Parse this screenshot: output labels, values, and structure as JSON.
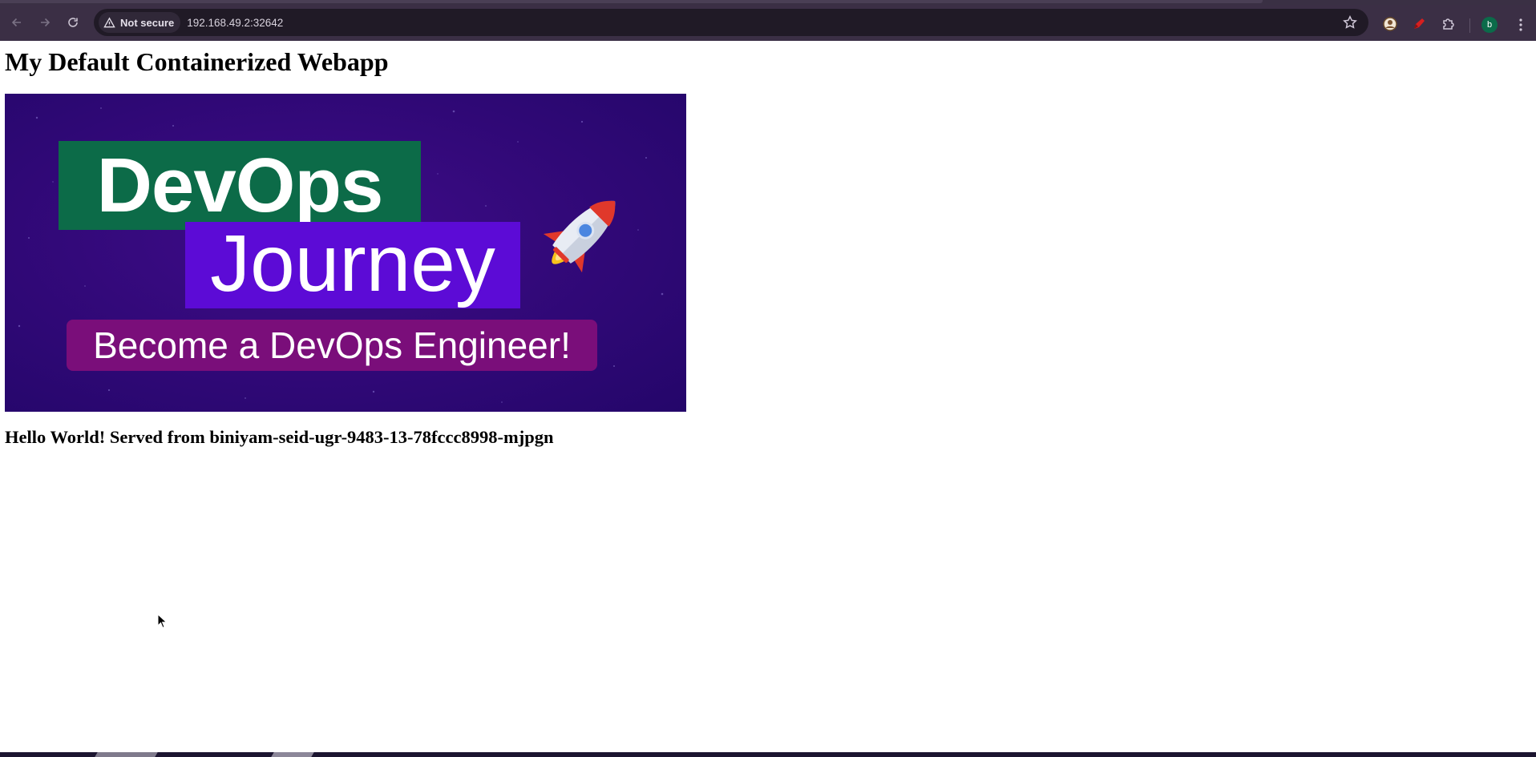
{
  "browser": {
    "back_icon": "arrow-left-icon",
    "forward_icon": "arrow-right-icon",
    "reload_icon": "reload-icon",
    "security_label": "Not secure",
    "url": "192.168.49.2:32642",
    "bookmark_icon": "star-icon",
    "profile_initial": "b",
    "menu_icon": "kebab-menu-icon",
    "colors": {
      "chrome_bg": "#3b2f45",
      "omnibox_bg": "#201a26",
      "profile_bg": "#0b6b4a"
    }
  },
  "page": {
    "heading": "My Default Containerized Webapp",
    "banner": {
      "line1": "DevOps",
      "line2": "Journey",
      "line3": "Become a DevOps Engineer!",
      "colors": {
        "background": "#33097a",
        "devops_box": "#0c6b48",
        "journey_box": "#5c0bd6",
        "tagline_box": "#7a0e7a"
      }
    },
    "message": "Hello World! Served from biniyam-seid-ugr-9483-13-78fccc8998-mjpgn"
  }
}
